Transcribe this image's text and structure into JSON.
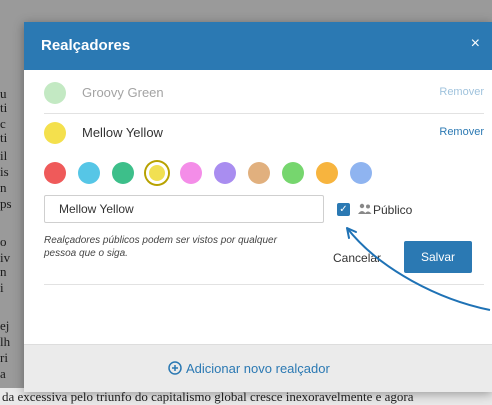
{
  "background_document": {
    "left_fragments": [
      "u",
      "ti",
      "c",
      "ti",
      "il",
      "is",
      "n",
      "ps",
      "o",
      "iv",
      "n",
      "i",
      "ej",
      "lh",
      "ri",
      "a"
    ],
    "bottom_line": "da excessiva pelo triunfo do capitalismo global cresce inexoravelmente e agora"
  },
  "modal": {
    "title": "Realçadores",
    "close_label": "×",
    "highlighters": [
      {
        "name": "Groovy Green",
        "color": "#7bcf7b",
        "remove_label": "Remover",
        "faded": true
      },
      {
        "name": "Mellow Yellow",
        "color": "#f4e04d",
        "remove_label": "Remover",
        "faded": false
      }
    ],
    "palette": [
      {
        "color": "#ef5a5a",
        "selected": false
      },
      {
        "color": "#56c6e6",
        "selected": false
      },
      {
        "color": "#3dbf8a",
        "selected": false
      },
      {
        "color": "#f1e052",
        "selected": true
      },
      {
        "color": "#f48de8",
        "selected": false
      },
      {
        "color": "#a98df0",
        "selected": false
      },
      {
        "color": "#e1b07e",
        "selected": false
      },
      {
        "color": "#76d66e",
        "selected": false
      },
      {
        "color": "#f7b43e",
        "selected": false
      },
      {
        "color": "#8fb4f0",
        "selected": false
      }
    ],
    "name_input_value": "Mellow Yellow",
    "public_checkbox_checked": true,
    "public_label": "Público",
    "note": "Realçadores públicos podem ser vistos por qualquer pessoa que o siga.",
    "cancel_label": "Cancelar",
    "save_label": "Salvar",
    "add_label": "Adicionar novo realçador"
  },
  "colors": {
    "accent": "#2b79b3",
    "annotation_arrow": "#1f72b5"
  }
}
